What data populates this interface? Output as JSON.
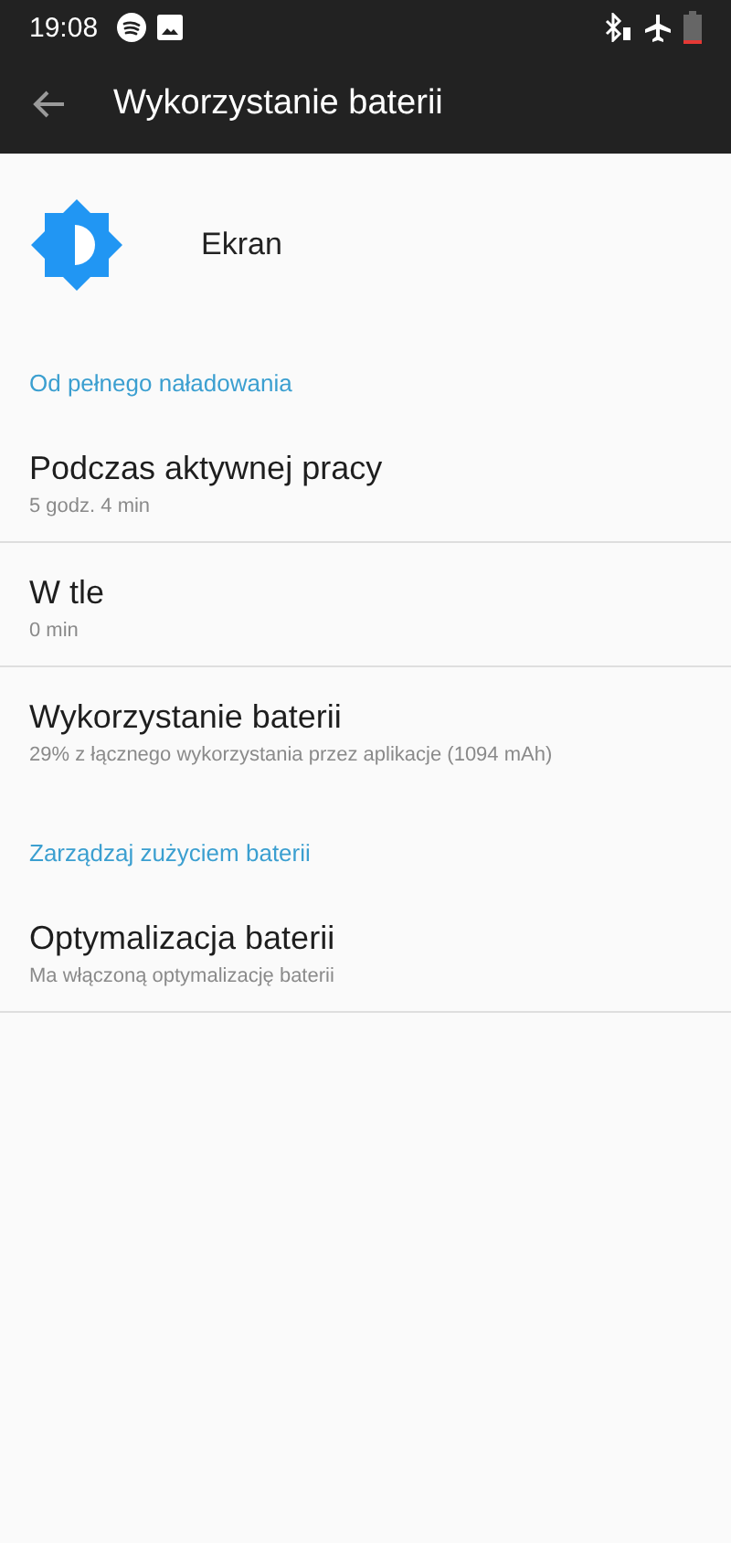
{
  "status_bar": {
    "time": "19:08"
  },
  "toolbar": {
    "title": "Wykorzystanie baterii"
  },
  "app": {
    "name": "Ekran"
  },
  "sections": [
    {
      "header": "Od pełnego naładowania",
      "items": [
        {
          "title": "Podczas aktywnej pracy",
          "summary": "5 godz. 4 min"
        },
        {
          "title": "W tle",
          "summary": "0 min"
        },
        {
          "title": "Wykorzystanie baterii",
          "summary": "29% z łącznego wykorzystania przez aplikacje (1094 mAh)"
        }
      ]
    },
    {
      "header": "Zarządzaj zużyciem baterii",
      "items": [
        {
          "title": "Optymalizacja baterii",
          "summary": "Ma włączoną optymalizację baterii"
        }
      ]
    }
  ]
}
